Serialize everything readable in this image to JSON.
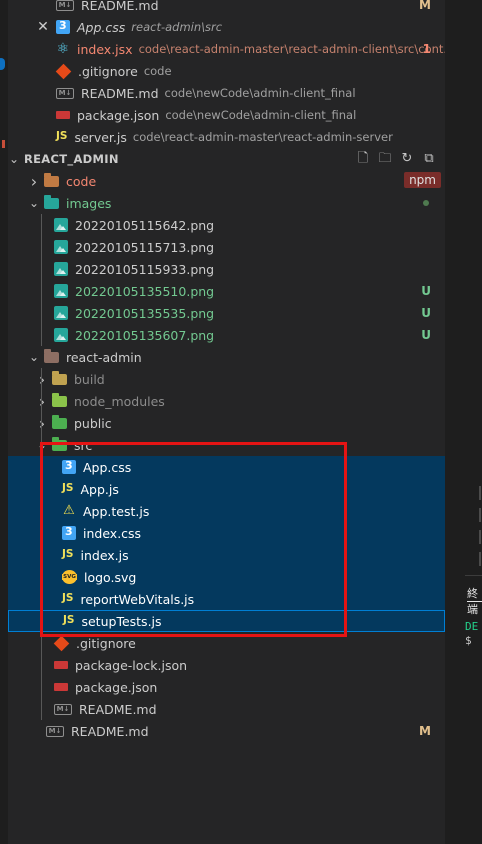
{
  "open_editors": [
    {
      "name": "README.md",
      "desc": "",
      "icon": "markdown-icon",
      "badge": "M",
      "badge_type": "m",
      "partial": true
    },
    {
      "name": "App.css",
      "desc": "react-admin\\src",
      "icon": "css-icon",
      "badge": "",
      "badge_type": "",
      "italic": true,
      "active": true
    },
    {
      "name": "index.jsx",
      "desc": "code\\react-admin-master\\react-admin-client\\src\\cont...",
      "icon": "react-icon",
      "badge": "1",
      "badge_type": "r",
      "name_color": "#f48771",
      "desc_color": "#c6826e"
    },
    {
      "name": ".gitignore",
      "desc": "code",
      "icon": "git-icon",
      "badge": "",
      "badge_type": ""
    },
    {
      "name": "README.md",
      "desc": "code\\newCode\\admin-client_final",
      "icon": "markdown-icon",
      "badge": "",
      "badge_type": ""
    },
    {
      "name": "package.json",
      "desc": "code\\newCode\\admin-client_final",
      "icon": "npm-icon",
      "badge": "",
      "badge_type": ""
    },
    {
      "name": "server.js",
      "desc": "code\\react-admin-master\\react-admin-server",
      "icon": "js-icon",
      "badge": "",
      "badge_type": ""
    }
  ],
  "section": {
    "title": "REACT_ADMIN"
  },
  "tree": [
    {
      "name": "code",
      "kind": "folder",
      "depth": 1,
      "open": false,
      "folder_color": "#c07a43",
      "color": "#f48771",
      "tag": "npm"
    },
    {
      "name": "images",
      "kind": "folder",
      "depth": 1,
      "open": true,
      "folder_color": "#26a69a",
      "color": "#73c991",
      "dot": true
    },
    {
      "name": "20220105115642.png",
      "kind": "img",
      "depth": 2
    },
    {
      "name": "20220105115713.png",
      "kind": "img",
      "depth": 2
    },
    {
      "name": "20220105115933.png",
      "kind": "img",
      "depth": 2
    },
    {
      "name": "20220105135510.png",
      "kind": "img",
      "depth": 2,
      "color": "#73c991",
      "badge": "U"
    },
    {
      "name": "20220105135535.png",
      "kind": "img",
      "depth": 2,
      "color": "#73c991",
      "badge": "U"
    },
    {
      "name": "20220105135607.png",
      "kind": "img",
      "depth": 2,
      "color": "#73c991",
      "badge": "U"
    },
    {
      "name": "react-admin",
      "kind": "folder",
      "depth": 1,
      "open": true,
      "folder_color": "#8d6e63"
    },
    {
      "name": "build",
      "kind": "folder",
      "depth": 2,
      "open": false,
      "folder_color": "#c0a250",
      "color": "#8c8c8c"
    },
    {
      "name": "node_modules",
      "kind": "folder",
      "depth": 2,
      "open": false,
      "folder_color": "#8bc34a",
      "color": "#8c8c8c"
    },
    {
      "name": "public",
      "kind": "folder",
      "depth": 2,
      "open": false,
      "folder_color": "#4caf50"
    },
    {
      "name": "src",
      "kind": "folder",
      "depth": 2,
      "open": true,
      "folder_color": "#4caf50",
      "partial": true
    },
    {
      "name": "App.css",
      "kind": "css",
      "depth": 3,
      "sel": true
    },
    {
      "name": "App.js",
      "kind": "js",
      "depth": 3,
      "sel": true
    },
    {
      "name": "App.test.js",
      "kind": "test",
      "depth": 3,
      "sel": true
    },
    {
      "name": "index.css",
      "kind": "css",
      "depth": 3,
      "sel": true
    },
    {
      "name": "index.js",
      "kind": "js",
      "depth": 3,
      "sel": true
    },
    {
      "name": "logo.svg",
      "kind": "svg",
      "depth": 3,
      "sel": true
    },
    {
      "name": "reportWebVitals.js",
      "kind": "js",
      "depth": 3,
      "sel": true
    },
    {
      "name": "setupTests.js",
      "kind": "js",
      "depth": 3,
      "sel": true,
      "focus": true
    },
    {
      "name": ".gitignore",
      "kind": "git",
      "depth": 2
    },
    {
      "name": "package-lock.json",
      "kind": "pkg",
      "depth": 2
    },
    {
      "name": "package.json",
      "kind": "pkg",
      "depth": 2
    },
    {
      "name": "README.md",
      "kind": "md",
      "depth": 2
    },
    {
      "name": "README.md",
      "kind": "md",
      "depth": 1,
      "badge": "M"
    }
  ],
  "terminal": {
    "tab": "終端",
    "debug": "DE",
    "prompt": "$"
  },
  "colors": {
    "selection": "#04395e",
    "focus_border": "#007fd4",
    "annotation_box": "#e51414"
  }
}
